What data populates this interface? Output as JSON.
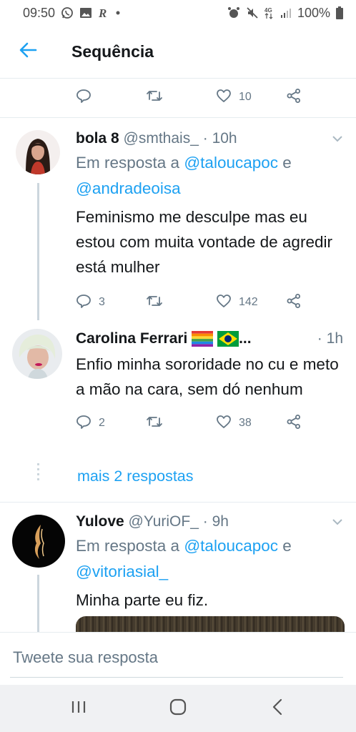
{
  "status_bar": {
    "time": "09:50",
    "battery": "100%",
    "network": "4G"
  },
  "header": {
    "title": "Sequência"
  },
  "top_actions": {
    "likes": "10"
  },
  "tweets": [
    {
      "name": "bola 8",
      "handle": "@smthais_",
      "separator": "·",
      "time": "10h",
      "reply_prefix": "Em resposta a",
      "reply_to_1": "@taloucapoc",
      "reply_joiner": "e",
      "reply_to_2": "@andradeoisa",
      "text": "Feminismo me desculpe mas eu estou com muita vontade de agredir está mulher",
      "replies": "3",
      "likes": "142"
    },
    {
      "name": "Carolina Ferrari",
      "name_suffix": "...",
      "separator": "·",
      "time": "1h",
      "text": "Enfio minha sororidade no cu e meto a mão na cara, sem dó nenhum",
      "replies": "2",
      "likes": "38"
    },
    {
      "name": "Yulove",
      "handle": "@YuriOF_",
      "separator": "·",
      "time": "9h",
      "reply_prefix": "Em resposta a",
      "reply_to_1": "@taloucapoc",
      "reply_joiner": "e",
      "reply_to_2": "@vitoriasial_",
      "text": "Minha parte eu fiz."
    }
  ],
  "more_replies": "mais 2 respostas",
  "compose": {
    "placeholder": "Tweete sua resposta"
  },
  "colors": {
    "accent": "#1da1f2",
    "secondary_text": "#657786",
    "primary_text": "#14171a",
    "divider": "#e6ecf0"
  },
  "icons": [
    "back-arrow-icon",
    "reply-icon",
    "retweet-icon",
    "like-icon",
    "share-icon",
    "caret-down-icon",
    "rainbow-flag-icon",
    "brazil-flag-icon"
  ]
}
